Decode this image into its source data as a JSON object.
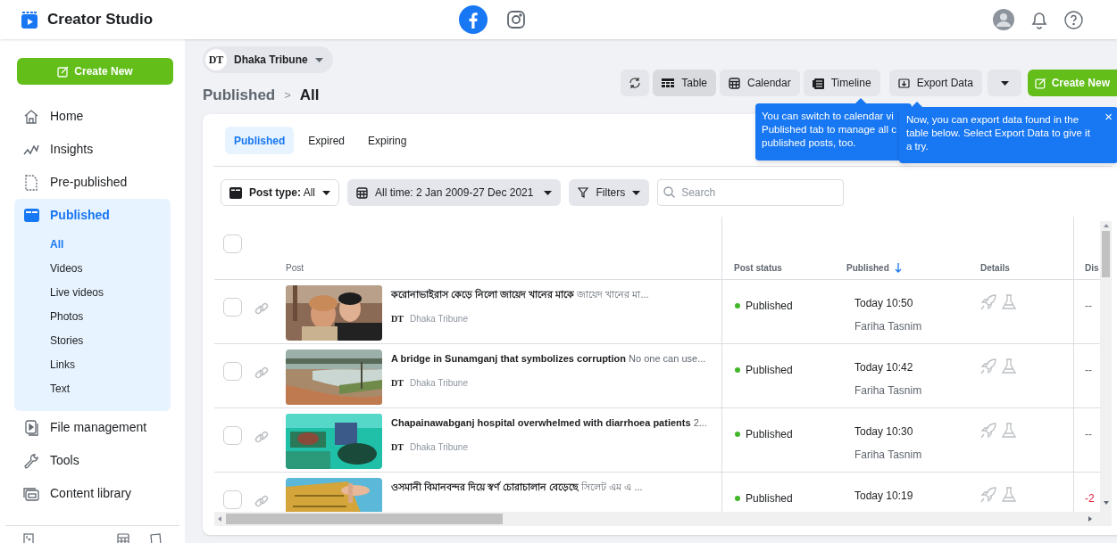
{
  "header": {
    "title": "Creator Studio",
    "platforms": [
      {
        "kind": "facebook",
        "selected": true
      },
      {
        "kind": "instagram",
        "selected": false
      }
    ]
  },
  "sidebar": {
    "create_button": "Create New",
    "items": [
      {
        "kind": "home",
        "label": "Home",
        "selected": false
      },
      {
        "kind": "insights",
        "label": "Insights",
        "selected": false
      },
      {
        "kind": "prepublished",
        "label": "Pre-published",
        "selected": false
      },
      {
        "kind": "published",
        "label": "Published",
        "selected": true,
        "expanded": true,
        "children": [
          {
            "label": "All",
            "selected": true
          },
          {
            "label": "Videos",
            "selected": false
          },
          {
            "label": "Live videos",
            "selected": false
          },
          {
            "label": "Photos",
            "selected": false
          },
          {
            "label": "Stories",
            "selected": false
          },
          {
            "label": "Links",
            "selected": false
          },
          {
            "label": "Text",
            "selected": false
          }
        ]
      },
      {
        "kind": "files",
        "label": "File management",
        "selected": false
      },
      {
        "kind": "tools",
        "label": "Tools",
        "selected": false
      },
      {
        "kind": "library",
        "label": "Content library",
        "selected": false
      }
    ]
  },
  "page_selector": {
    "logo": "DT",
    "name": "Dhaka Tribune"
  },
  "breadcrumb": {
    "parent": "Published",
    "separator": ">",
    "current": "All"
  },
  "toolbar": {
    "views": [
      {
        "kind": "table",
        "label": "Table",
        "selected": true
      },
      {
        "kind": "calendar",
        "label": "Calendar",
        "selected": false
      },
      {
        "kind": "timeline",
        "label": "Timeline",
        "selected": false
      }
    ],
    "export": "Export Data",
    "create": "Create New"
  },
  "tooltips": [
    {
      "lines": [
        "You can switch to calendar vi",
        "Published tab to manage all c",
        "published posts, too."
      ]
    },
    {
      "text": "Now, you can export data found in the table below. Select Export Data to give it a try.",
      "close": "×"
    }
  ],
  "tabs": [
    {
      "label": "Published",
      "selected": true
    },
    {
      "label": "Expired",
      "selected": false
    },
    {
      "label": "Expiring",
      "selected": false
    }
  ],
  "filters": {
    "post_type_label": "Post type:",
    "post_type_value": "All",
    "date": "All time: 2 Jan 2009-27 Dec 2021",
    "filters": "Filters",
    "search_placeholder": "Search"
  },
  "table": {
    "select_all_checked": false,
    "columns": [
      "Post",
      "Post status",
      "Published",
      "Details",
      "Dis"
    ],
    "rows": [
      {
        "title": "করোনাভাইরাস কেড়ে নিলো জায়েদ খানের মাকে",
        "snippet": "জায়েদ খানের মা...",
        "source_logo": "DT",
        "source": "Dhaka Tribune",
        "checked": false,
        "status": "Published",
        "time": "Today 10:50",
        "author": "Fariha Tasnim",
        "column_5": "--",
        "column_5_negative": false
      },
      {
        "title": "A bridge in Sunamganj that symbolizes corruption",
        "snippet": "No one can use...",
        "source_logo": "DT",
        "source": "Dhaka Tribune",
        "checked": false,
        "status": "Published",
        "time": "Today 10:42",
        "author": "Fariha Tasnim",
        "column_5": "--",
        "column_5_negative": false
      },
      {
        "title": "Chapainawabganj hospital overwhelmed with diarrhoea patients",
        "snippet": "2...",
        "source_logo": "DT",
        "source": "Dhaka Tribune",
        "checked": false,
        "status": "Published",
        "time": "Today 10:30",
        "author": "Fariha Tasnim",
        "column_5": "--",
        "column_5_negative": false
      },
      {
        "title": "ওসমানী বিমানবন্দর দিয়ে স্বর্ণ চোরাচালান বেড়েছে",
        "snippet": "সিলেট এম এ ...",
        "checked": false,
        "status": "Published",
        "time": "Today 10:19",
        "column_5": "-2",
        "column_5_negative": true
      }
    ]
  }
}
